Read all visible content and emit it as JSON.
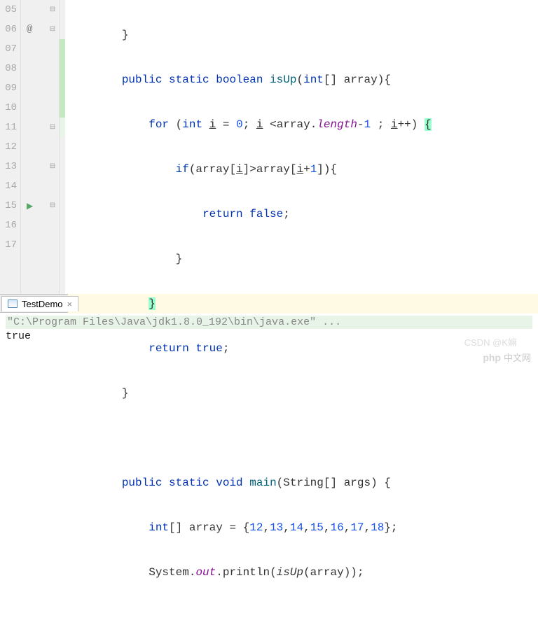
{
  "line_numbers": [
    "05",
    "06",
    "07",
    "08",
    "09",
    "10",
    "11",
    "12",
    "13",
    "14",
    "15",
    "16",
    "17"
  ],
  "code": {
    "l05": "}",
    "l06": {
      "pub": "public",
      "stat": "static",
      "ret": "boolean",
      "name": "isUp",
      "params": "(",
      "int": "int",
      "arr": "[] array){"
    },
    "l07": {
      "for": "for",
      "open": " (",
      "int": "int",
      "i1": "i",
      "eq": " = ",
      "zero": "0",
      "semi": "; ",
      "i2": "i",
      "lt": " <array.",
      "len": "length",
      "minus": "-",
      "one": "1",
      "semi2": " ; ",
      "i3": "i",
      "inc": "++) ",
      "brace": "{"
    },
    "l08": {
      "if": "if",
      "txt1": "(array[",
      "i1": "i",
      "txt2": "]>array[",
      "i2": "i",
      "txt3": "+",
      "one": "1",
      "txt4": "]){"
    },
    "l09": {
      "ret": "return",
      "val": " false",
      "semi": ";"
    },
    "l10": "}",
    "l11": "}",
    "l12": {
      "ret": "return",
      "val": " true",
      "semi": ";"
    },
    "l13": "}",
    "l15": {
      "pub": "public",
      "stat": "static",
      "ret": "void",
      "name": "main",
      "p1": "(String[] args) {"
    },
    "l16": {
      "int": "int",
      "txt": "[] array = {",
      "n1": "12",
      "c": ",",
      "n2": "13",
      "n3": "14",
      "n4": "15",
      "n5": "16",
      "n6": "17",
      "n7": "18",
      "end": "};"
    },
    "l17": {
      "sys": "System.",
      "out": "out",
      "pr": ".println(",
      "call": "isUp",
      "txt": "(array));"
    }
  },
  "console": {
    "tab": "TestDemo",
    "cmd": "\"C:\\Program Files\\Java\\jdk1.8.0_192\\bin\\java.exe\" ...",
    "output": "true"
  },
  "watermark": {
    "php": "php",
    "cn": "中文网"
  },
  "csdn": "CSDN @K嫲"
}
